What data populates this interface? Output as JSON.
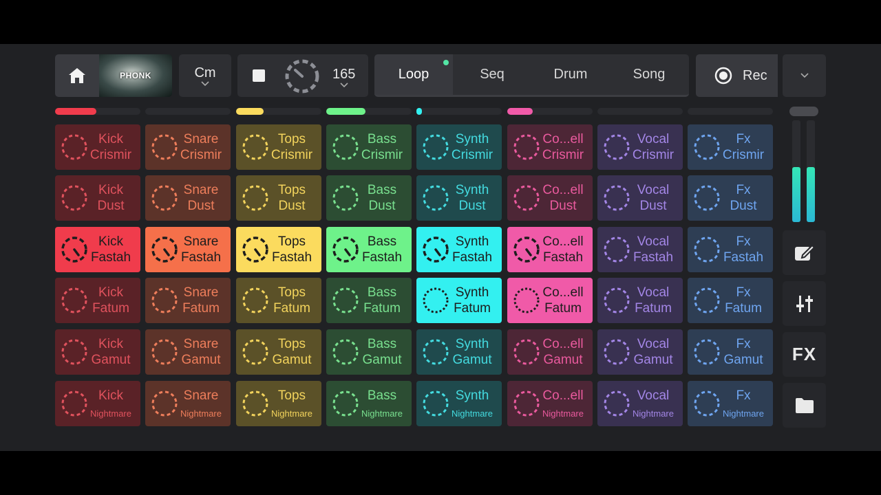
{
  "header": {
    "kit_label": "PHONK",
    "key": "Cm",
    "tempo": "165",
    "tabs": [
      {
        "label": "Loop",
        "active": true
      },
      {
        "label": "Seq",
        "active": false
      },
      {
        "label": "Drum",
        "active": false
      },
      {
        "label": "Song",
        "active": false
      }
    ],
    "record_label": "Rec"
  },
  "tracks": [
    {
      "name": "Kick",
      "color": "#f03c4c",
      "dark": "#5a2227",
      "dim_text": "#e0525d",
      "level": 0.48
    },
    {
      "name": "Snare",
      "color": "#f5704a",
      "dark": "#5c3329",
      "dim_text": "#ee7e5b",
      "level": 0
    },
    {
      "name": "Tops",
      "color": "#fbdb5e",
      "dark": "#5b5128",
      "dim_text": "#f2d35c",
      "level": 0.32
    },
    {
      "name": "Bass",
      "color": "#6ef28a",
      "dark": "#2c4d33",
      "dim_text": "#79e08f",
      "level": 0.46
    },
    {
      "name": "Synth",
      "color": "#33f0f0",
      "dark": "#1f4a4d",
      "dim_text": "#44dbe0",
      "level": 0.05
    },
    {
      "name": "Co...ell",
      "color": "#f05aa8",
      "dark": "#4d2636",
      "dim_text": "#ea5a9e",
      "level": 0.3
    },
    {
      "name": "Vocal",
      "color": "#8c60dd",
      "dark": "#393151",
      "dim_text": "#a386e6",
      "level": 0
    },
    {
      "name": "Fx",
      "color": "#4f8ee8",
      "dark": "#2e3e54",
      "dim_text": "#6fa5f0",
      "level": 0
    }
  ],
  "scenes": [
    "Crismir",
    "Dust",
    "Fastah",
    "Fatum",
    "Gamut",
    "Nightmare"
  ],
  "pad_states": [
    [
      "off",
      "off",
      "off",
      "off",
      "off",
      "off",
      "off",
      "off"
    ],
    [
      "off",
      "off",
      "off",
      "off",
      "off",
      "off",
      "off",
      "off"
    ],
    [
      "playing",
      "playing",
      "playing",
      "playing",
      "playing",
      "playing",
      "off",
      "off"
    ],
    [
      "off",
      "off",
      "off",
      "off",
      "queued",
      "queued",
      "off",
      "off"
    ],
    [
      "off",
      "off",
      "off",
      "off",
      "off",
      "off",
      "off",
      "off"
    ],
    [
      "off",
      "off",
      "off",
      "off",
      "off",
      "off",
      "off",
      "off"
    ]
  ],
  "master_levels": [
    0.5,
    0.5
  ],
  "side_buttons": [
    {
      "name": "edit-icon"
    },
    {
      "name": "mixer-icon"
    },
    {
      "name": "fx-label",
      "label": "FX"
    },
    {
      "name": "folder-icon"
    }
  ]
}
